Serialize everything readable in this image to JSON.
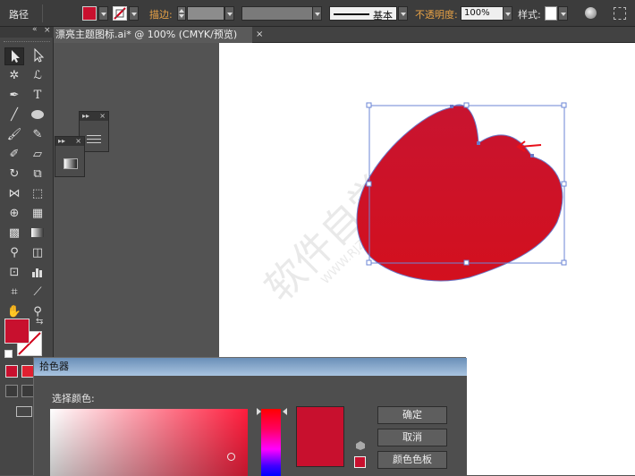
{
  "control_bar": {
    "object_type": "路径",
    "fill_color": "#c8102e",
    "stroke_label": "描边:",
    "stroke_style": "基本",
    "opacity_label": "不透明度:",
    "opacity_value": "100%",
    "style_label": "样式:"
  },
  "document_tab": {
    "title": "漂亮主题图标.ai* @ 100% (CMYK/预览)",
    "close": "×"
  },
  "color_picker": {
    "title": "拾色器",
    "select_label": "选择颜色:",
    "current_color": "#c8102e",
    "ok_label": "确定",
    "cancel_label": "取消",
    "swatches_label": "颜色色板"
  },
  "artwork": {
    "shape_color": "#c8102e",
    "watermark_text": "软件自学网",
    "watermark_url": "WWW.RJZXW.COM"
  }
}
